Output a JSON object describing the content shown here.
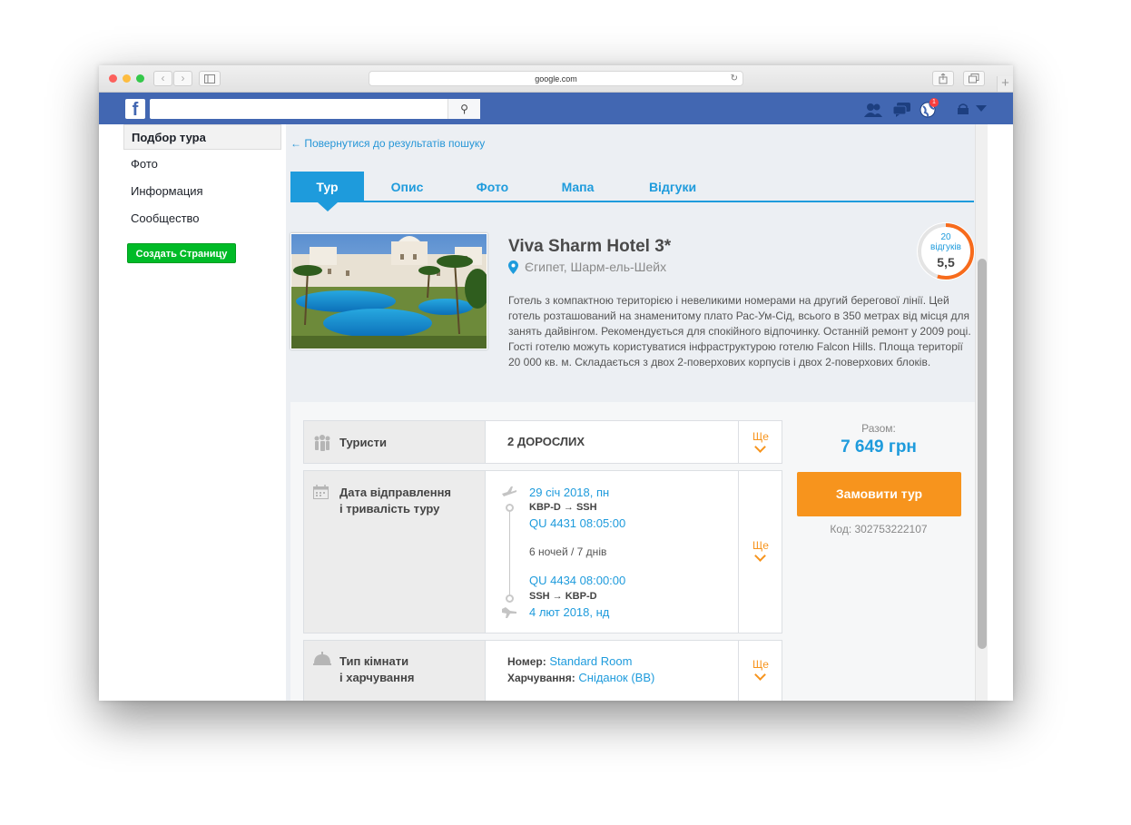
{
  "browser": {
    "url": "google.com",
    "back_icon": "‹",
    "forward_icon": "›",
    "reload_icon": "↻",
    "plus_icon": "+"
  },
  "facebook": {
    "logo": "f",
    "search_placeholder": "",
    "search_icon": "⚲"
  },
  "sidebar": {
    "items": [
      {
        "label": "Подбор тура"
      },
      {
        "label": "Фото"
      },
      {
        "label": "Информация"
      },
      {
        "label": "Сообщество"
      }
    ],
    "create_button": "Создать Страницу"
  },
  "tour": {
    "back_link": "← Повернутися до результатів пошуку",
    "tabs": [
      {
        "label": "Тур"
      },
      {
        "label": "Опис"
      },
      {
        "label": "Фото"
      },
      {
        "label": "Мапа"
      },
      {
        "label": "Відгуки"
      }
    ],
    "hotel_name": "Viva Sharm Hotel 3*",
    "location": "Єгипет, Шарм-ель-Шейх",
    "description": "Готель з компактною територією і невеликими номерами на другий берегової лінії. Цей готель розташований на знаменитому плато Рас-Ум-Сід, всього в 350 метрах від місця для занять дайвінгом. Рекомендується для спокійного відпочинку. Останній ремонт у 2009 році. Гості готелю можуть користуватися інфраструктурою готелю Falcon Hills. Площа території 20 000 кв. м. Складається з двох 2-поверхових корпусів і двох 2-поверхових блоків.",
    "rating": {
      "count_line1": "20",
      "count_line2": "відгуків",
      "value": "5,5",
      "fraction": 0.55
    },
    "tourists": {
      "label": "Туристи",
      "value": "2 ДОРОСЛИХ",
      "more": "Ще"
    },
    "dates": {
      "label_line1": "Дата відправлення",
      "label_line2": "і тривалість туру",
      "depart_date": "29 січ 2018, пн",
      "depart_route": "KBP-D → SSH",
      "depart_flight": "QU 4431 08:05:00",
      "duration": "6 ночей / 7 днів",
      "return_flight": "QU 4434 08:00:00",
      "return_route": "SSH → KBP-D",
      "return_date": "4 лют 2018, нд",
      "more": "Ще"
    },
    "room": {
      "label_line1": "Тип кімнати",
      "label_line2": "і харчування",
      "room_label": "Номер:",
      "room_value": "Standard Room",
      "meal_label": "Харчування:",
      "meal_value": "Сніданок (BB)",
      "more": "Ще"
    },
    "price_label": "Разом:",
    "price": "7 649 грн",
    "order_button": "Замовити тур",
    "code": "Код: 302753222107"
  },
  "colors": {
    "fb_blue": "#4267b2",
    "accent_blue": "#1e9bdc",
    "orange": "#f7941d",
    "green": "#00bb27"
  }
}
